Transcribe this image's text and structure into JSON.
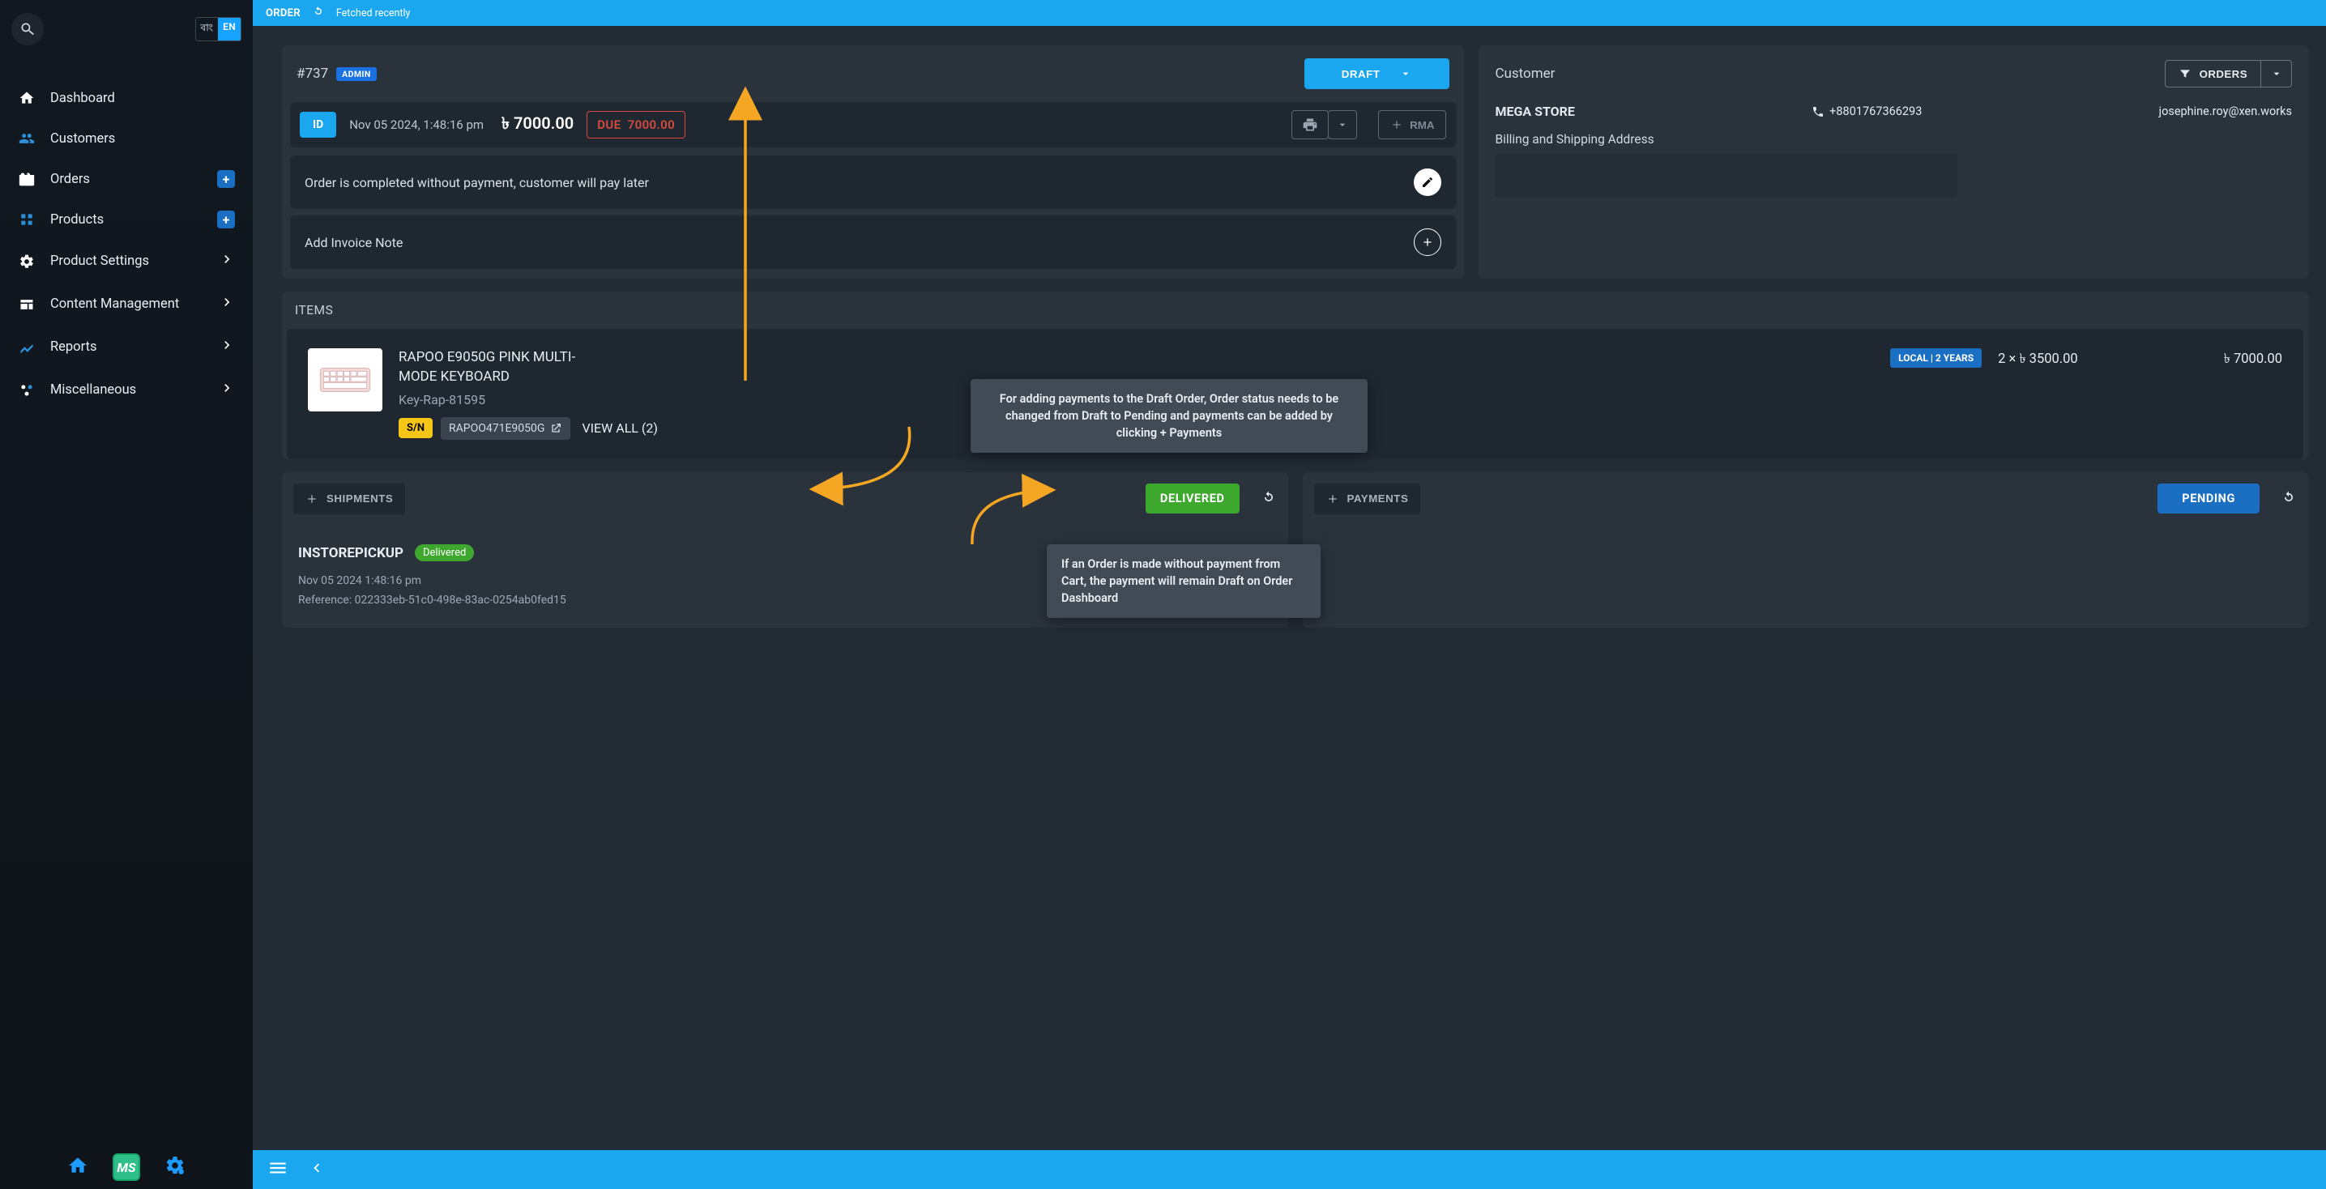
{
  "topbar": {
    "section": "ORDER",
    "status": "Fetched recently"
  },
  "sidebar": {
    "lang_inactive": "বাং",
    "lang_active": "EN",
    "items": [
      {
        "label": "Dashboard"
      },
      {
        "label": "Customers"
      },
      {
        "label": "Orders"
      },
      {
        "label": "Products"
      },
      {
        "label": "Product Settings"
      },
      {
        "label": "Content Management"
      },
      {
        "label": "Reports"
      },
      {
        "label": "Miscellaneous"
      }
    ],
    "ms": "MS"
  },
  "order": {
    "id_text": "#737",
    "admin": "ADMIN",
    "status_btn": "DRAFT",
    "id_chip": "ID",
    "datetime": "Nov 05 2024, 1:48:16 pm",
    "amount": "৳ 7000.00",
    "due_label": "DUE",
    "due_value": "7000.00",
    "rma": "RMA",
    "note": "Order is completed without payment, customer will pay later",
    "add_invoice_note": "Add Invoice Note"
  },
  "customer": {
    "title": "Customer",
    "orders_btn": "ORDERS",
    "store": "MEGA STORE",
    "phone": "+8801767366293",
    "email": "josephine.roy@xen.works",
    "addr_label": "Billing and Shipping Address"
  },
  "items": {
    "title": "ITEMS",
    "name": "RAPOO E9050G PINK MULTI-MODE KEYBOARD",
    "sku": "Key-Rap-81595",
    "sn_chip": "S/N",
    "serial": "RAPOO471E9050G",
    "view_all": "VIEW ALL (2)",
    "badge": "LOCAL | 2 YEARS",
    "qty": "2 × ৳ 3500.00",
    "total": "৳ 7000.00"
  },
  "shipments": {
    "add": "SHIPMENTS",
    "delivered_chip": "DELIVERED",
    "title": "INSTOREPICKUP",
    "delivered_pill": "Delivered",
    "date": "Nov 05 2024 1:48:16 pm",
    "ref": "Reference: 022333eb-51c0-498e-83ac-0254ab0fed15"
  },
  "payments": {
    "add": "PAYMENTS",
    "pending_chip": "PENDING"
  },
  "tooltips": {
    "t1": "For adding payments to the Draft Order, Order status needs to be changed from Draft to Pending and payments can be added by clicking + Payments",
    "t2": "If an Order is made without payment from Cart, the payment will remain Draft on Order Dashboard"
  }
}
